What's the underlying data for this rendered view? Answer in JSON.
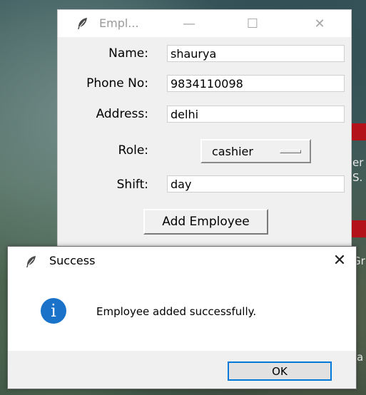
{
  "main_window": {
    "title": "Empl...",
    "minimize_glyph": "—",
    "maximize_glyph": "☐",
    "close_glyph": "✕",
    "form": {
      "name_label": "Name:",
      "name_value": "shaurya",
      "phone_label": "Phone No:",
      "phone_value": "9834110098",
      "address_label": "Address:",
      "address_value": "delhi",
      "role_label": "Role:",
      "role_value": "cashier",
      "shift_label": "Shift:",
      "shift_value": "day"
    },
    "add_button_label": "Add Employee"
  },
  "dialog": {
    "title": "Success",
    "close_glyph": "✕",
    "icon_glyph": "i",
    "message": "Employee added successfully.",
    "ok_label": "OK"
  },
  "background": {
    "fragments": [
      "er",
      "S.",
      "Gr",
      "a"
    ]
  },
  "colors": {
    "accent": "#0078d7",
    "info_icon": "#1a73c8",
    "background_red": "#b3121a"
  },
  "icons": {
    "app_icon": "feather-icon",
    "info_icon": "info-icon"
  }
}
